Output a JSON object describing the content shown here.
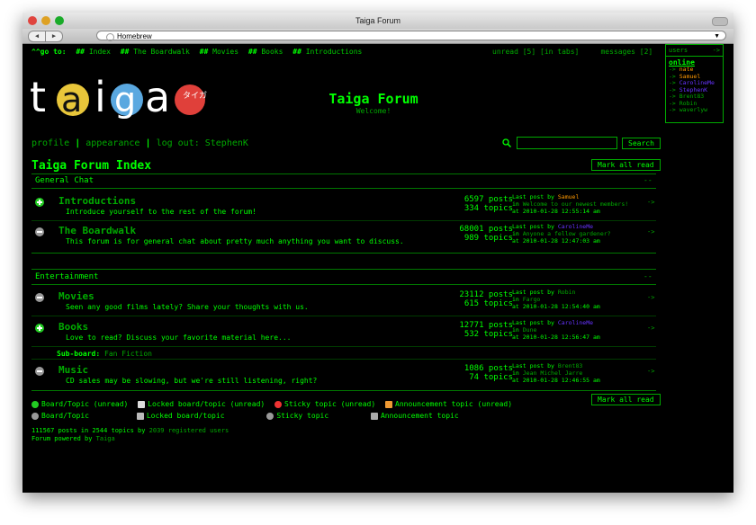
{
  "window": {
    "title": "Taiga Forum",
    "url": "Homebrew"
  },
  "topnav": {
    "goto_label": "^^go to:",
    "links": [
      "Index",
      "The Boardwalk",
      "Movies",
      "Books",
      "Introductions"
    ],
    "unread": "unread [5]",
    "in_tabs": "[in tabs]",
    "messages": "messages [2]"
  },
  "users_box": {
    "header": "users",
    "arrow": "->",
    "online_label": "online",
    "users": [
      {
        "name": "nate",
        "color": "#ff9900"
      },
      {
        "name": "Samuel",
        "color": "#ff9900"
      },
      {
        "name": "CarolineMe",
        "color": "#6633ff"
      },
      {
        "name": "StephenK",
        "color": "#6633ff"
      },
      {
        "name": "Brent83",
        "color": "#0a0"
      },
      {
        "name": "Robin",
        "color": "#0a0"
      },
      {
        "name": "waverlyw",
        "color": "#0a0"
      }
    ],
    "user_prefix": "->"
  },
  "logo": {
    "letters": [
      "t",
      "a",
      "i",
      "g",
      "a"
    ],
    "badge_text": "タイガ"
  },
  "site": {
    "title": "Taiga Forum",
    "subtitle": "Welcome!"
  },
  "profile_bar": {
    "profile": "profile",
    "appearance": "appearance",
    "logout": "log out: StephenK"
  },
  "search": {
    "button": "Search"
  },
  "index_title": "Taiga Forum Index",
  "mark_all_read": "Mark all read",
  "categories": [
    {
      "name": "General Chat",
      "forums": [
        {
          "name": "Introductions",
          "desc": "Introduce yourself to the rest of the forum!",
          "posts": "6597 posts",
          "topics": "334 topics",
          "last_by_label": "Last post by",
          "last_by": "Samuel",
          "last_by_color": "#ff9900",
          "in_label": "in",
          "in_topic": "Welcome to our newest members!",
          "at": "at 2010-01-28 12:55:14 am",
          "unread": true
        },
        {
          "name": "The Boardwalk",
          "desc": "This forum is for general chat about pretty much anything you want to discuss.",
          "posts": "68001 posts",
          "topics": "989 topics",
          "last_by_label": "Last post by",
          "last_by": "CarolineMe",
          "last_by_color": "#6633ff",
          "in_label": "in",
          "in_topic": "Anyone a fellow gardener?",
          "at": "at 2010-01-28 12:47:03 am",
          "unread": false
        }
      ]
    },
    {
      "name": "Entertainment",
      "forums": [
        {
          "name": "Movies",
          "desc": "Seen any good films lately? Share your thoughts with us.",
          "posts": "23112 posts",
          "topics": "615 topics",
          "last_by_label": "Last post by",
          "last_by": "Robin",
          "last_by_color": "#0a0",
          "in_label": "in",
          "in_topic": "Fargo",
          "at": "at 2010-01-28 12:54:40 am",
          "unread": false
        },
        {
          "name": "Books",
          "desc": "Love to read? Discuss your favorite material here...",
          "posts": "12771 posts",
          "topics": "532 topics",
          "last_by_label": "Last post by",
          "last_by": "CarolineMe",
          "last_by_color": "#6633ff",
          "in_label": "in",
          "in_topic": "Dune",
          "at": "at 2010-01-28 12:56:47 am",
          "unread": true
        },
        {
          "name": "Music",
          "desc": "CD sales may be slowing, but we're still listening, right?",
          "posts": "1086 posts",
          "topics": "74 topics",
          "last_by_label": "Last post by",
          "last_by": "Brent83",
          "last_by_color": "#0a0",
          "in_label": "in",
          "in_topic": "Jean Michel Jarre",
          "at": "at 2010-01-28 12:46:55 am",
          "unread": false
        }
      ]
    }
  ],
  "subboard": {
    "label": "Sub-board:",
    "name": "Fan Fiction"
  },
  "legend": {
    "row1": [
      "Board/Topic (unread)",
      "Locked board/topic (unread)",
      "Sticky topic (unread)",
      "Announcement topic (unread)"
    ],
    "row2": [
      "Board/Topic",
      "Locked board/topic",
      "Sticky topic",
      "Announcement topic"
    ]
  },
  "footer": {
    "stats_prefix": "111567 posts in 2544 topics by",
    "registered": "2039 registered users",
    "powered_prefix": "Forum powered by",
    "powered_name": "Taiga"
  },
  "colors": {
    "accent": "#00ff00",
    "dim": "#00aa00",
    "background": "#000000",
    "orange": "#ff9900",
    "purple": "#6633ff"
  }
}
